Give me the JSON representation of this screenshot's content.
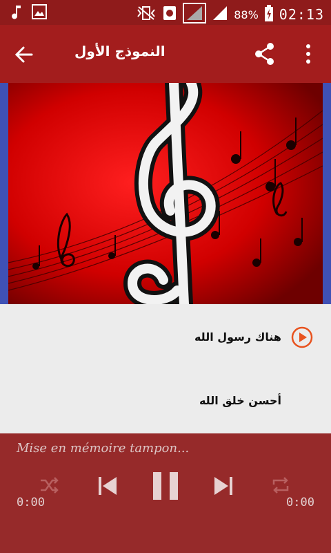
{
  "status_bar": {
    "battery_percent": "88%",
    "time": "02:13",
    "icons": [
      "music-note-icon",
      "image-icon",
      "vibrate-icon",
      "signal-icon",
      "battery-icon"
    ]
  },
  "app_bar": {
    "title": "النموذج الأول",
    "icons": [
      "back-arrow-icon",
      "share-icon",
      "more-vert-icon"
    ]
  },
  "tracks": [
    {
      "title": "هناك رسول الله",
      "playing": true
    },
    {
      "title": "أحسن خلق الله",
      "playing": false
    }
  ],
  "player": {
    "status": "Mise en mémoire tampon...",
    "elapsed": "0:00",
    "duration": "0:00",
    "icons": [
      "shuffle-icon",
      "previous-icon",
      "pause-icon",
      "next-icon",
      "repeat-icon"
    ]
  },
  "colors": {
    "status_bar": "#8f1b1b",
    "app_bar": "#a31d1d",
    "player": "#962a2a",
    "accent": "#e8531f",
    "side_bars": "#3f51b5"
  }
}
